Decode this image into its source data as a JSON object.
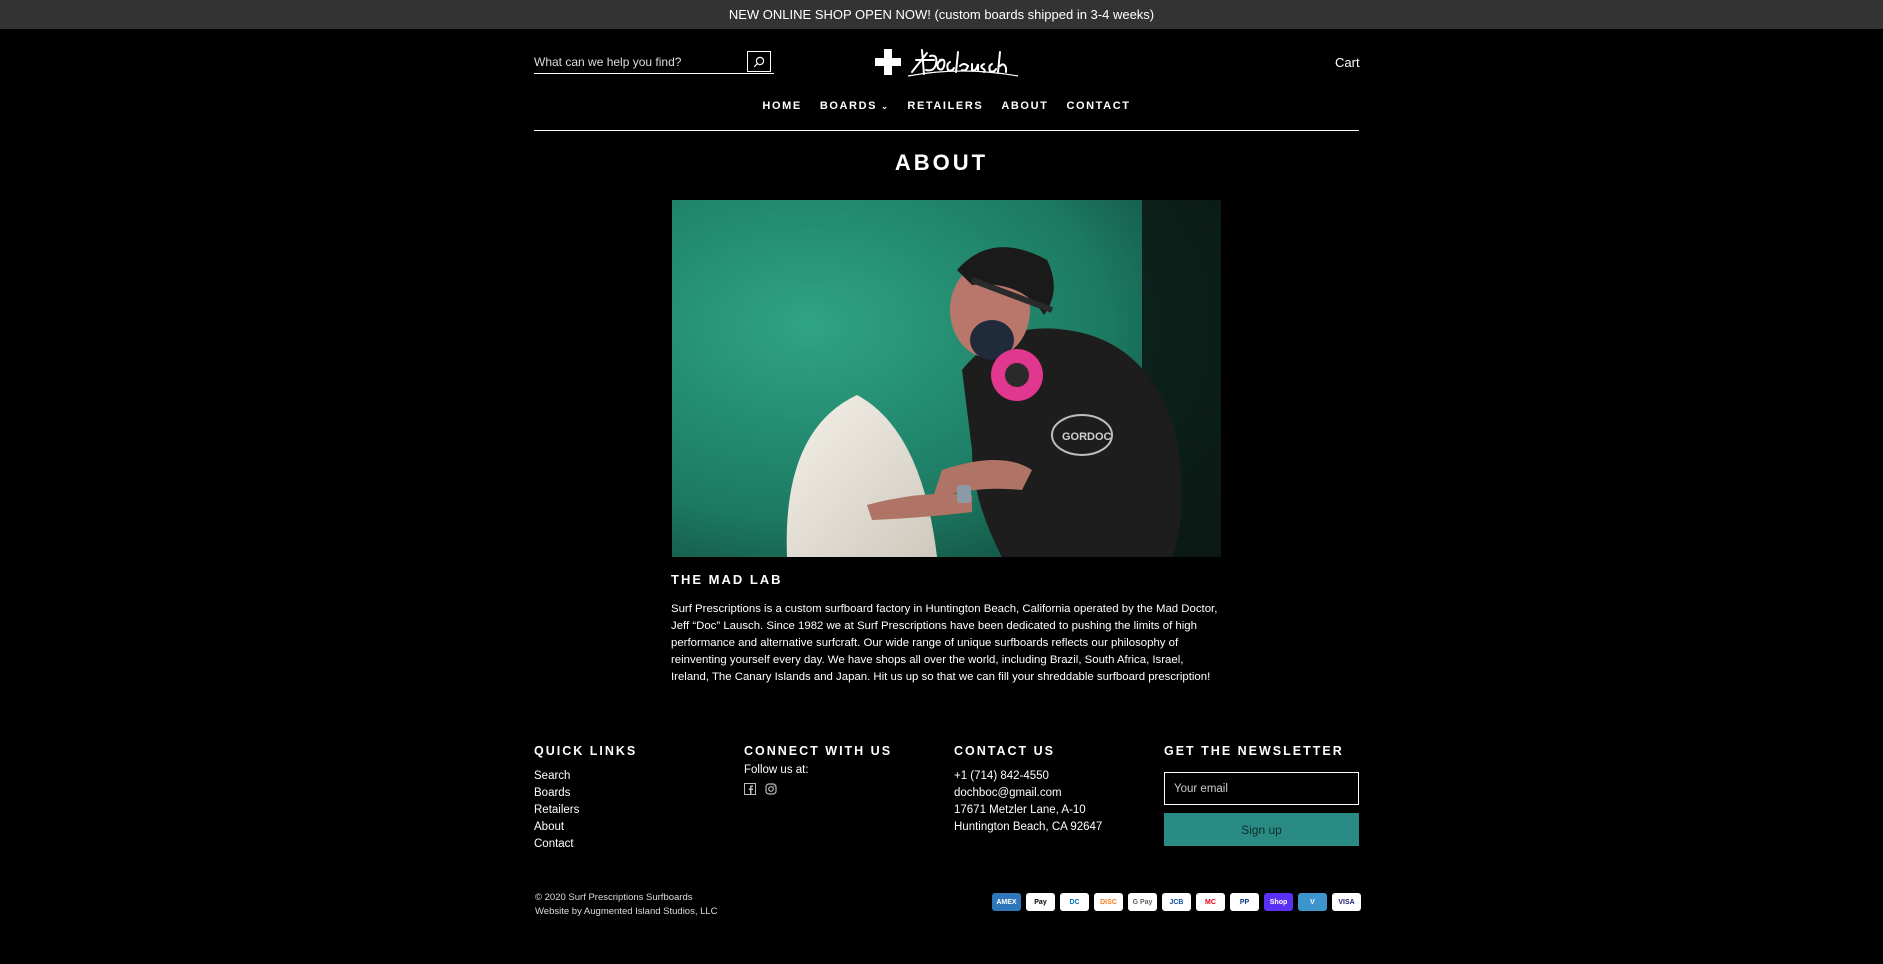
{
  "announcement": "NEW ONLINE SHOP OPEN NOW! (custom boards shipped in 3-4 weeks)",
  "search": {
    "placeholder": "What can we help you find?"
  },
  "header": {
    "cart_label": "Cart"
  },
  "nav": [
    {
      "label": "HOME"
    },
    {
      "label": "BOARDS"
    },
    {
      "label": "RETAILERS"
    },
    {
      "label": "ABOUT"
    },
    {
      "label": "CONTACT"
    }
  ],
  "page": {
    "title": "ABOUT",
    "section_heading": "THE MAD LAB",
    "body": "Surf Prescriptions is a custom surfboard factory in Huntington Beach, California operated by the Mad Doctor, Jeff “Doc” Lausch. Since 1982 we at Surf Prescriptions have been dedicated to pushing the limits of high performance and alternative surfcraft. Our wide range of unique surfboards reflects our philosophy of reinventing yourself every day. We have shops all over the world, including Brazil, South Africa, Israel, Ireland, The Canary Islands and Japan. Hit us up so that we can fill your shreddable surfboard prescription!"
  },
  "footer": {
    "quick_links": {
      "heading": "QUICK LINKS",
      "items": [
        "Search",
        "Boards",
        "Retailers",
        "About",
        "Contact"
      ]
    },
    "connect": {
      "heading": "CONNECT WITH US",
      "follow_text": "Follow us at:",
      "icons": [
        "facebook-icon",
        "instagram-icon"
      ]
    },
    "contact": {
      "heading": "CONTACT US",
      "phone": "+1 (714) 842-4550",
      "email": "dochboc@gmail.com",
      "address1": "17671 Metzler Lane, A-10",
      "address2": "Huntington Beach, CA 92647"
    },
    "newsletter": {
      "heading": "GET THE NEWSLETTER",
      "placeholder": "Your email",
      "button_label": "Sign up"
    },
    "copyright": "© 2020 Surf Prescriptions Surfboards",
    "credit": "Website by Augmented Island Studios, LLC",
    "payments": [
      {
        "name": "American Express",
        "short": "AMEX",
        "bg": "#2e77bb",
        "fg": "#ffffff"
      },
      {
        "name": "Apple Pay",
        "short": "Pay",
        "bg": "#ffffff",
        "fg": "#000000"
      },
      {
        "name": "Diners Club",
        "short": "DC",
        "bg": "#ffffff",
        "fg": "#0079be"
      },
      {
        "name": "Discover",
        "short": "DISC",
        "bg": "#ffffff",
        "fg": "#f48120"
      },
      {
        "name": "Google Pay",
        "short": "G Pay",
        "bg": "#ffffff",
        "fg": "#5f6368"
      },
      {
        "name": "JCB",
        "short": "JCB",
        "bg": "#ffffff",
        "fg": "#0b4ea2"
      },
      {
        "name": "Mastercard",
        "short": "MC",
        "bg": "#ffffff",
        "fg": "#eb001b"
      },
      {
        "name": "PayPal",
        "short": "PP",
        "bg": "#ffffff",
        "fg": "#003087"
      },
      {
        "name": "Shop Pay",
        "short": "Shop",
        "bg": "#5a31f4",
        "fg": "#ffffff"
      },
      {
        "name": "Venmo",
        "short": "V",
        "bg": "#3d95ce",
        "fg": "#ffffff"
      },
      {
        "name": "Visa",
        "short": "VISA",
        "bg": "#ffffff",
        "fg": "#1a1f71"
      }
    ]
  },
  "colors": {
    "accent": "#2a8b85",
    "announcement_bg": "#333333",
    "background": "#000000"
  }
}
